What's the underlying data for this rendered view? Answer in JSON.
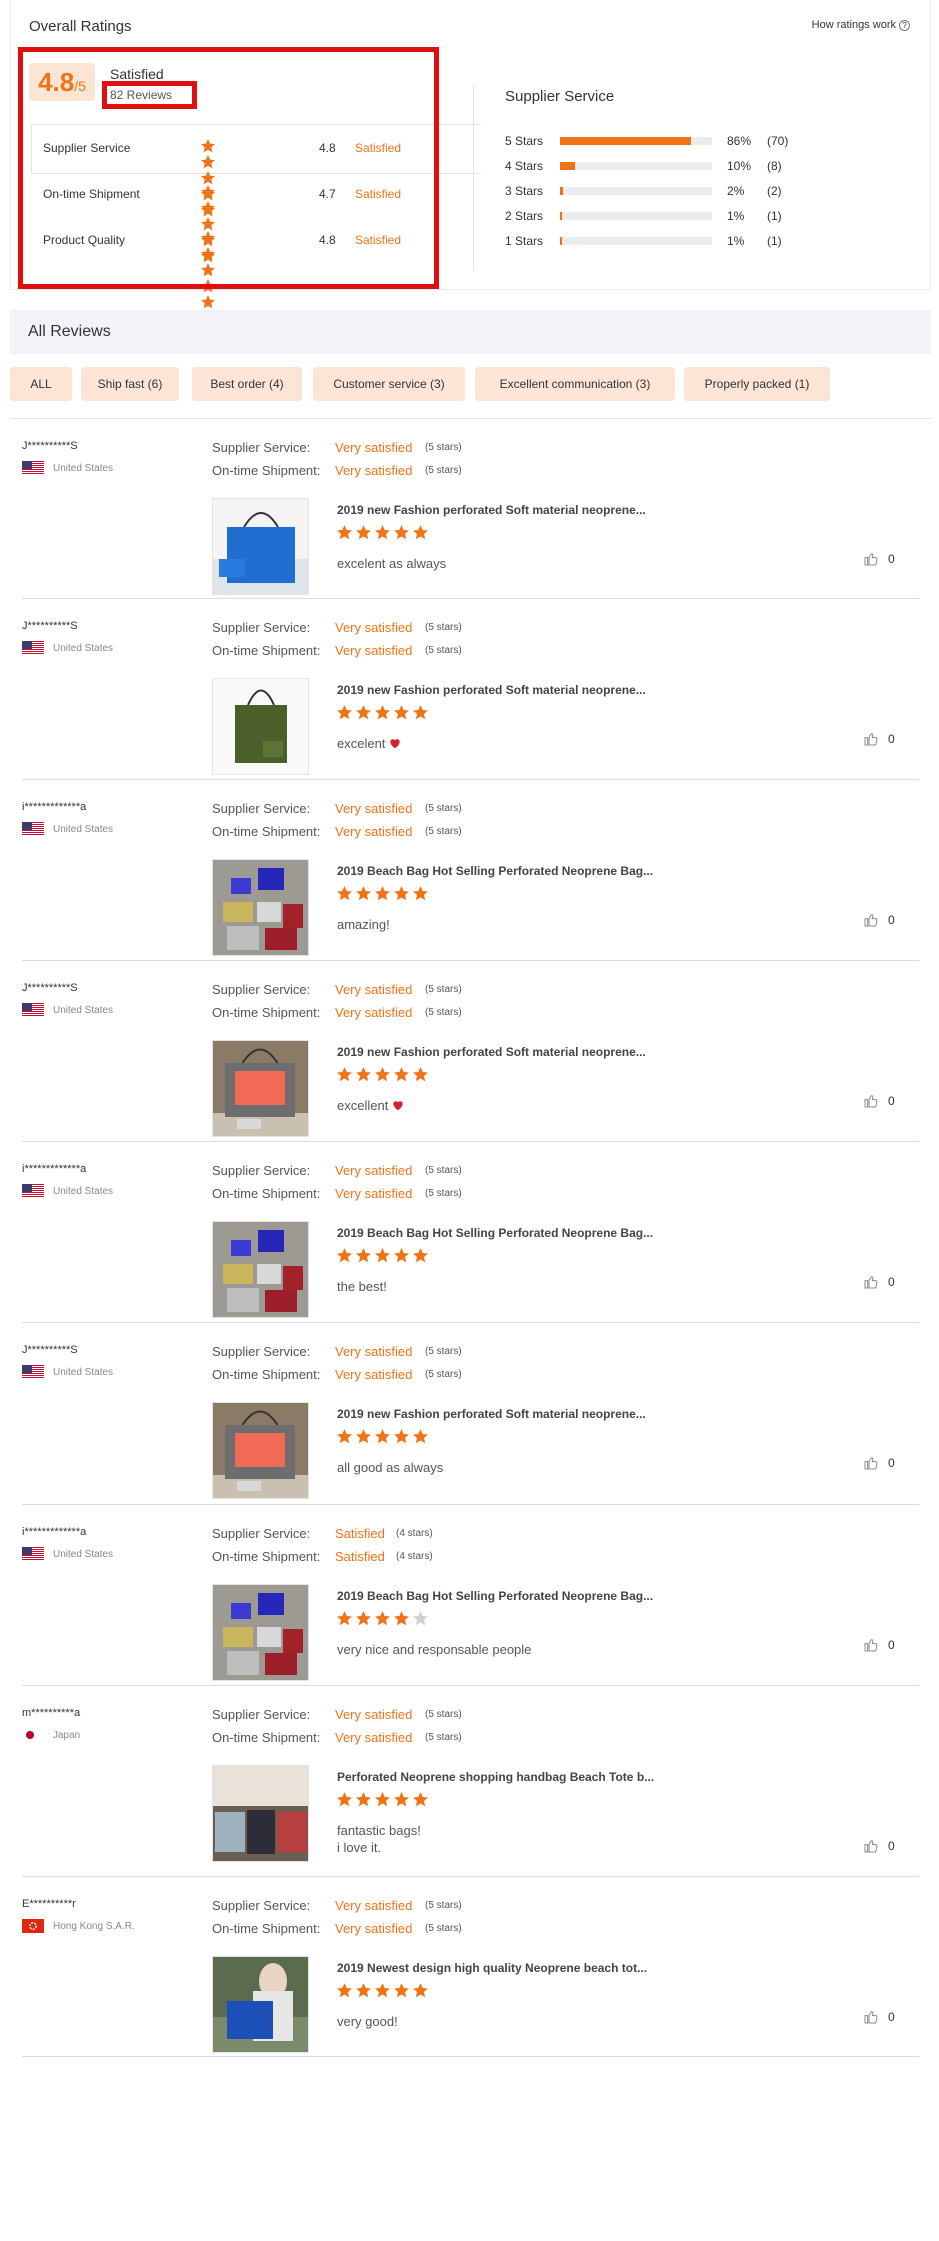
{
  "overall": {
    "title": "Overall Ratings",
    "how_link": "How ratings work",
    "score": "4.8",
    "score_max": "/5",
    "label": "Satisfied",
    "reviews_count": "82 Reviews",
    "sub_ratings": [
      {
        "name": "Supplier Service",
        "value": "4.8",
        "stars": 5,
        "label": "Satisfied"
      },
      {
        "name": "On-time Shipment",
        "value": "4.7",
        "stars": 5,
        "label": "Satisfied"
      },
      {
        "name": "Product Quality",
        "value": "4.8",
        "stars": 5,
        "label": "Satisfied"
      }
    ]
  },
  "distribution": {
    "title": "Supplier Service",
    "rows": [
      {
        "label": "5 Stars",
        "pct": "86%",
        "count": "(70)",
        "fraction": 0.86
      },
      {
        "label": "4 Stars",
        "pct": "10%",
        "count": "(8)",
        "fraction": 0.1
      },
      {
        "label": "3 Stars",
        "pct": "2%",
        "count": "(2)",
        "fraction": 0.02
      },
      {
        "label": "2 Stars",
        "pct": "1%",
        "count": "(1)",
        "fraction": 0.01
      },
      {
        "label": "1 Stars",
        "pct": "1%",
        "count": "(1)",
        "fraction": 0.01
      }
    ]
  },
  "all_reviews": {
    "title": "All Reviews",
    "tags": [
      "ALL",
      "Ship fast (6)",
      "Best order (4)",
      "Customer service (3)",
      "Excellent communication (3)",
      "Properly packed (1)"
    ]
  },
  "labels": {
    "supplier_service": "Supplier Service:",
    "ontime_shipment": "On-time Shipment:"
  },
  "colors": {
    "accent": "#f07317",
    "tag_bg": "#fde5d6",
    "highlight": "#e01010",
    "star_empty": "#d0d0d0"
  },
  "reviews": [
    {
      "user": "J**********S",
      "country": "United States",
      "flag": "us",
      "ss": "Very satisfied",
      "ss_stars": "(5 stars)",
      "os": "Very satisfied",
      "os_stars": "(5 stars)",
      "product": "2019 new Fashion perforated Soft material neoprene...",
      "rating": 5,
      "comment": "excelent as always",
      "heart": false,
      "likes": "0",
      "img": "blue"
    },
    {
      "user": "J**********S",
      "country": "United States",
      "flag": "us",
      "ss": "Very satisfied",
      "ss_stars": "(5 stars)",
      "os": "Very satisfied",
      "os_stars": "(5 stars)",
      "product": "2019 new Fashion perforated Soft material neoprene...",
      "rating": 5,
      "comment": "excelent",
      "heart": true,
      "likes": "0",
      "img": "green"
    },
    {
      "user": "i*************a",
      "country": "United States",
      "flag": "us",
      "ss": "Very satisfied",
      "ss_stars": "(5 stars)",
      "os": "Very satisfied",
      "os_stars": "(5 stars)",
      "product": "2019 Beach Bag Hot Selling Perforated Neoprene Bag...",
      "rating": 5,
      "comment": "amazing!",
      "heart": false,
      "likes": "0",
      "img": "multi"
    },
    {
      "user": "J**********S",
      "country": "United States",
      "flag": "us",
      "ss": "Very satisfied",
      "ss_stars": "(5 stars)",
      "os": "Very satisfied",
      "os_stars": "(5 stars)",
      "product": "2019 new Fashion perforated Soft material neoprene...",
      "rating": 5,
      "comment": "excellent",
      "heart": true,
      "likes": "0",
      "img": "grey"
    },
    {
      "user": "i*************a",
      "country": "United States",
      "flag": "us",
      "ss": "Very satisfied",
      "ss_stars": "(5 stars)",
      "os": "Very satisfied",
      "os_stars": "(5 stars)",
      "product": "2019 Beach Bag Hot Selling Perforated Neoprene Bag...",
      "rating": 5,
      "comment": "the best!",
      "heart": false,
      "likes": "0",
      "img": "multi"
    },
    {
      "user": "J**********S",
      "country": "United States",
      "flag": "us",
      "ss": "Very satisfied",
      "ss_stars": "(5 stars)",
      "os": "Very satisfied",
      "os_stars": "(5 stars)",
      "product": "2019 new Fashion perforated Soft material neoprene...",
      "rating": 5,
      "comment": "all good as always",
      "heart": false,
      "likes": "0",
      "img": "grey"
    },
    {
      "user": "i*************a",
      "country": "United States",
      "flag": "us",
      "ss": "Satisfied",
      "ss_stars": "(4 stars)",
      "os": "Satisfied",
      "os_stars": "(4 stars)",
      "product": "2019 Beach Bag Hot Selling Perforated Neoprene Bag...",
      "rating": 4,
      "comment": "very nice and responsable people",
      "heart": false,
      "likes": "0",
      "img": "multi"
    },
    {
      "user": "m**********a",
      "country": "Japan",
      "flag": "jp",
      "ss": "Very satisfied",
      "ss_stars": "(5 stars)",
      "os": "Very satisfied",
      "os_stars": "(5 stars)",
      "product": "Perforated Neoprene shopping handbag Beach Tote b...",
      "rating": 5,
      "comment": "fantastic bags!\ni love it.",
      "heart": false,
      "likes": "0",
      "img": "shelf"
    },
    {
      "user": "E**********r",
      "country": "Hong Kong S.A.R.",
      "flag": "hk",
      "ss": "Very satisfied",
      "ss_stars": "(5 stars)",
      "os": "Very satisfied",
      "os_stars": "(5 stars)",
      "product": "2019 Newest design high quality Neoprene beach tot...",
      "rating": 5,
      "comment": "very good!",
      "heart": false,
      "likes": "0",
      "img": "person"
    }
  ]
}
